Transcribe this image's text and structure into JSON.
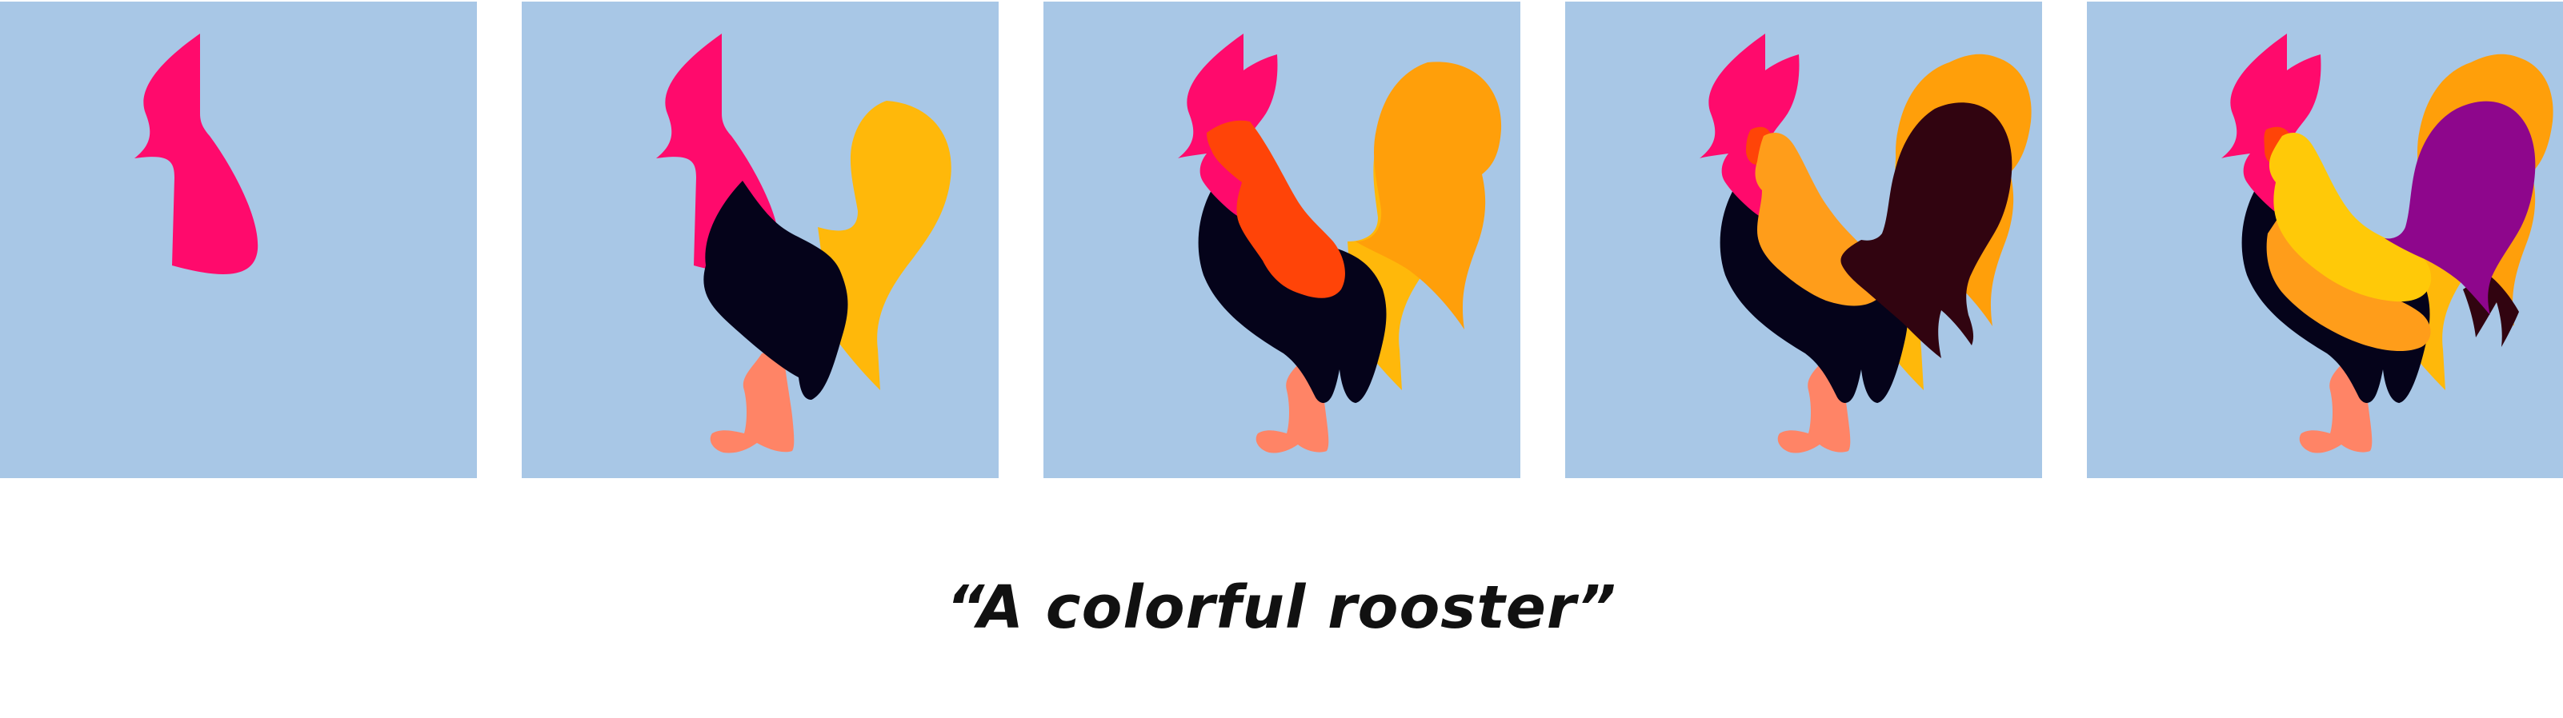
{
  "caption": "“A colorful rooster”",
  "colors": {
    "background": "#a8c7e6",
    "comb_head": "#ff0a6c",
    "tail_yellow": "#ffb80a",
    "tail_orange": "#ff9f0a",
    "body_dark": "#05031a",
    "leg_salmon": "#ff8466",
    "wing_red": "#ff4408",
    "wing_dark_maroon": "#310410",
    "neck_orange": "#ff9d1a",
    "breast_yellow": "#ffc908",
    "wing_purple": "#8e068c"
  },
  "panels": [
    {
      "stage": 1
    },
    {
      "stage": 2
    },
    {
      "stage": 3
    },
    {
      "stage": 4
    },
    {
      "stage": 5
    }
  ]
}
